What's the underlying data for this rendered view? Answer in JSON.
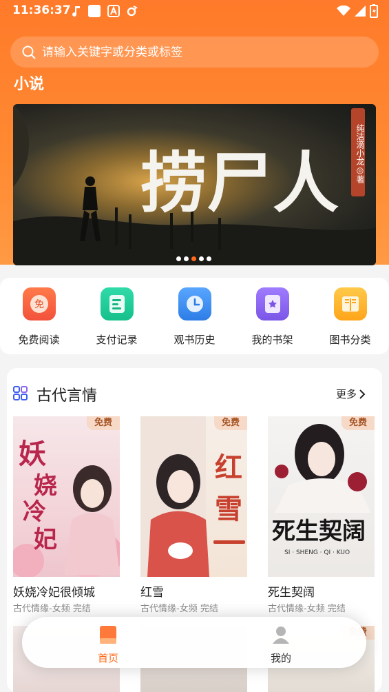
{
  "status": {
    "time": "11:36:37"
  },
  "search": {
    "placeholder": "请输入关键字或分类或标签"
  },
  "section": {
    "title": "小说"
  },
  "banner": {
    "title": "捞尸人",
    "author": "纯洁滴小龙◎著",
    "dots": 5,
    "active_dot": 3
  },
  "quick_menu": [
    {
      "label": "免费阅读",
      "icon": "free-read-icon",
      "color": "#f2623a"
    },
    {
      "label": "支付记录",
      "icon": "payment-record-icon",
      "color": "#1ec89a"
    },
    {
      "label": "观书历史",
      "icon": "clock-history-icon",
      "color": "#3d8ef2"
    },
    {
      "label": "我的书架",
      "icon": "bookshelf-icon",
      "color": "#8b66ee"
    },
    {
      "label": "图书分类",
      "icon": "book-category-icon",
      "color": "#ffb21f"
    }
  ],
  "category": {
    "title": "古代言情",
    "more": "更多",
    "badge": "免费",
    "books": [
      {
        "title": "妖娆冷妃很倾城",
        "meta": "古代情缘-女频 完结",
        "cover_text": "妖娆冷妃"
      },
      {
        "title": "红雪",
        "meta": "古代情缘-女频 完结",
        "cover_text": "红雪"
      },
      {
        "title": "死生契阔",
        "meta": "古代情缘-女频 完结",
        "cover_text": "死生契阔"
      }
    ]
  },
  "bottom_nav": [
    {
      "label": "首页",
      "icon": "home-book-icon",
      "active": true
    },
    {
      "label": "我的",
      "icon": "profile-icon",
      "active": false
    }
  ],
  "colors": {
    "accent": "#ff7a2a",
    "active_nav": "#ff6a1a"
  }
}
